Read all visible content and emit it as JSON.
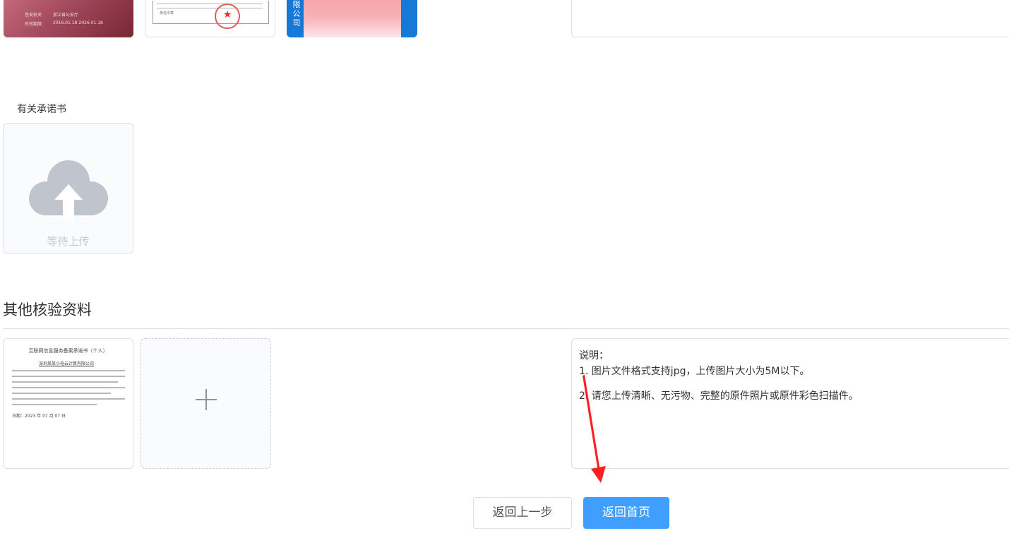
{
  "id_thumbs": {
    "id_card_text": [
      "签发机关",
      "浙江省公安厅",
      "有效期限",
      "2016.01.18-2026.01.18"
    ],
    "license_text": "单位印章",
    "photo_side_text": "限公司"
  },
  "commitment": {
    "label": "有关承诺书",
    "upload_status": "等待上传"
  },
  "other_section": {
    "title": "其他核验资料",
    "doc_title": "互联网信息服务备案承诺书（个人）",
    "doc_company": "深圳某某小电云计算有限公司",
    "doc_date": "日期：2023 年 07 月 07 日",
    "add_icon": "plus-icon"
  },
  "notes": {
    "heading": "说明：",
    "items": [
      "1. 图片文件格式支持jpg，上传图片大小为5M以下。",
      "2. 请您上传清晰、无污物、完整的原件照片或原件彩色扫描件。"
    ]
  },
  "buttons": {
    "back": "返回上一步",
    "home": "返回首页"
  },
  "colors": {
    "primary": "#409eff",
    "annotation_arrow": "#ff1f1f",
    "upload_icon": "#c0c4cc"
  }
}
